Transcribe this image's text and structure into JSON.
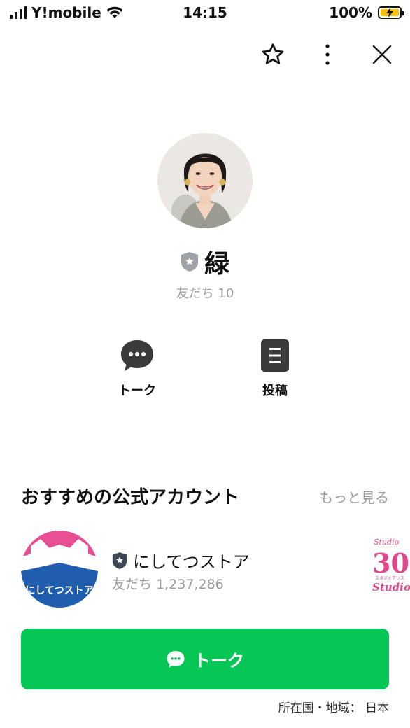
{
  "status_bar": {
    "carrier": "Y!mobile",
    "time": "14:15",
    "battery": "100%",
    "battery_level": 1.0
  },
  "top_actions": [
    "star-icon",
    "more-vertical-icon",
    "close-icon"
  ],
  "profile": {
    "name": "緑",
    "friends_count": "友だち 10",
    "badge_icon": "official-shield-icon"
  },
  "actions": {
    "talk_label": "トーク",
    "post_label": "投稿"
  },
  "recommended": {
    "title": "おすすめの公式アカウント",
    "see_more": "もっと見る",
    "accounts": [
      {
        "name": "にしてつストア",
        "friends": "友だち 1,237,286",
        "logo_text": "にしてつストア"
      },
      {
        "logo_text_top": "Studio",
        "logo_number": "30",
        "logo_sub": "スタジオアリス",
        "logo_text_bottom": "Studio A"
      }
    ]
  },
  "cta": {
    "label": "トーク"
  },
  "footer": {
    "region": "所在国・地域： 日本"
  },
  "colors": {
    "line_green": "#06c755",
    "muted_text": "#9a9a9a",
    "badge_gray": "#9ea3a8",
    "badge_dark": "#3c4654"
  }
}
